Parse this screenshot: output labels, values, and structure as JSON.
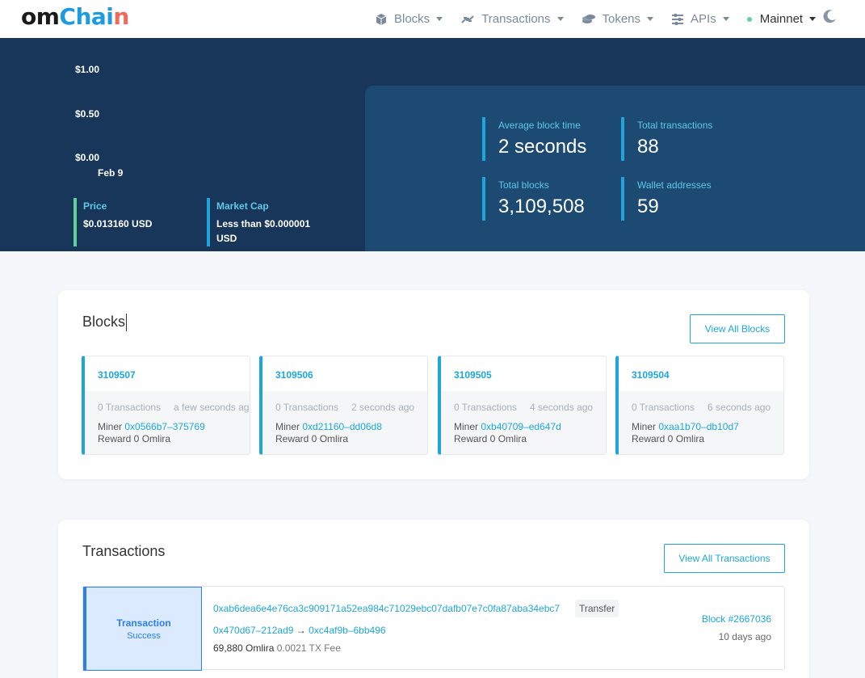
{
  "brand": {
    "part1": "om",
    "part2": "Chai",
    "part3": "n"
  },
  "nav": {
    "blocks": "Blocks",
    "transactions": "Transactions",
    "tokens": "Tokens",
    "apis": "APIs",
    "network": "Mainnet"
  },
  "hero": {
    "chart_data": {
      "type": "line",
      "ytick_labels": [
        "$1.00",
        "$0.50",
        "$0.00"
      ],
      "xtick_labels": [
        "Feb 9"
      ]
    },
    "price": {
      "title": "Price",
      "value": "$0.013160 USD"
    },
    "market_cap": {
      "title": "Market Cap",
      "value_line1": "Less than $0.000001",
      "value_line2": "USD"
    },
    "stats": {
      "avg_block_time": {
        "title": "Average block time",
        "value": "2 seconds"
      },
      "total_transactions": {
        "title": "Total transactions",
        "value": "88"
      },
      "total_blocks": {
        "title": "Total blocks",
        "value": "3,109,508"
      },
      "wallet_addresses": {
        "title": "Wallet addresses",
        "value": "59"
      }
    }
  },
  "blocks_section": {
    "title": "Blocks",
    "view_all": "View All Blocks",
    "items": [
      {
        "number": "3109507",
        "tx": "0 Transactions",
        "ago": "a few seconds ago",
        "miner_label": "Miner",
        "miner": "0x0566b7–375769",
        "reward": "Reward 0 Omlira"
      },
      {
        "number": "3109506",
        "tx": "0 Transactions",
        "ago": "2 seconds ago",
        "miner_label": "Miner",
        "miner": "0xd21160–dd06d8",
        "reward": "Reward 0 Omlira"
      },
      {
        "number": "3109505",
        "tx": "0 Transactions",
        "ago": "4 seconds ago",
        "miner_label": "Miner",
        "miner": "0xb40709–ed647d",
        "reward": "Reward 0 Omlira"
      },
      {
        "number": "3109504",
        "tx": "0 Transactions",
        "ago": "6 seconds ago",
        "miner_label": "Miner",
        "miner": "0xaa1b70–db10d7",
        "reward": "Reward 0 Omlira"
      }
    ]
  },
  "transactions_section": {
    "title": "Transactions",
    "view_all": "View All Transactions",
    "items": [
      {
        "status_title": "Transaction",
        "status": "Success",
        "hash": "0xab6dea6e4e76ca3c909171a52ea984c71029ebc07dafb07e7c0fa87aba34ebc7",
        "type": "Transfer",
        "from": "0x470d67–212ad9",
        "arrow": "→",
        "to": "0xc4af9b–6bb496",
        "value": "69,880 Omlira",
        "fee": "0.0021 TX Fee",
        "block": "Block #2667036",
        "ago": "10 days ago"
      }
    ]
  },
  "colors": {
    "hero_bg": "#18365a",
    "stats_bg": "#1d4a72",
    "accent": "#1ea6dc",
    "success_green": "#5ed39a",
    "status_blue": "#2a7ef0"
  }
}
